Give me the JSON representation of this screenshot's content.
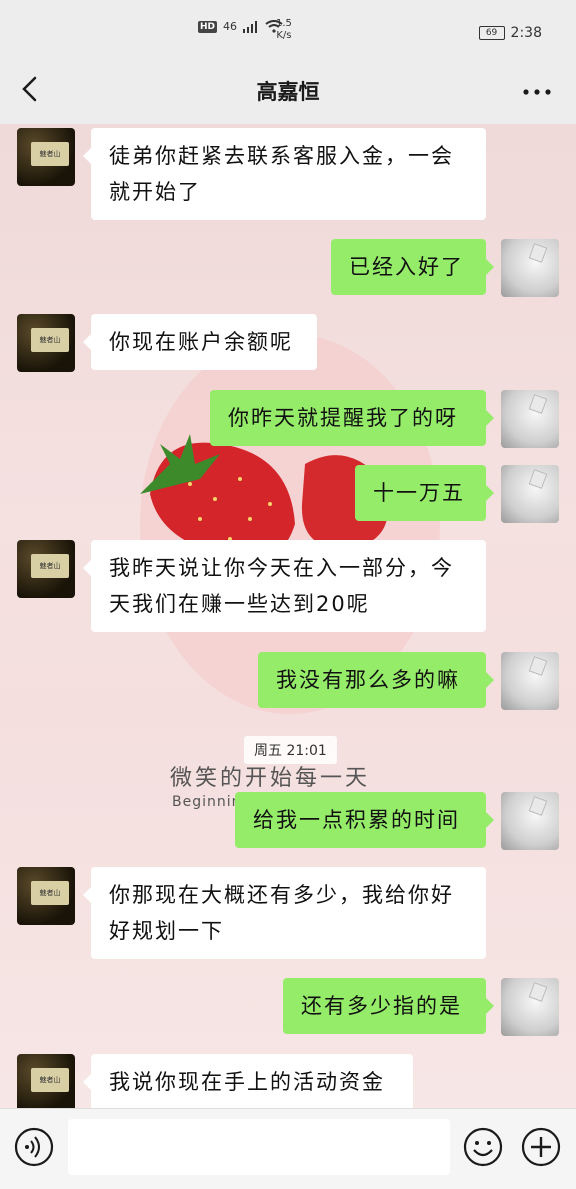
{
  "status": {
    "network": "46",
    "hd": "HD",
    "speed_value": "1.5",
    "speed_unit": "K/s",
    "battery": "69",
    "time": "2:38"
  },
  "header": {
    "title": "高嘉恒"
  },
  "messages": [
    {
      "side": "in",
      "text_lines": [
        "徒弟你赶紧去联系客服入金，一会",
        "就开始了"
      ]
    },
    {
      "side": "out",
      "text_lines": [
        "已经入好了"
      ]
    },
    {
      "side": "in",
      "text_lines": [
        "你现在账户余额呢"
      ]
    },
    {
      "side": "out",
      "text_lines": [
        "你昨天就提醒我了的呀"
      ]
    },
    {
      "side": "out",
      "text_lines": [
        "十一万五"
      ]
    },
    {
      "side": "in",
      "text_lines": [
        "我昨天说让你今天在入一部分，今",
        "天我们在赚一些达到20呢"
      ]
    },
    {
      "side": "out",
      "text_lines": [
        "我没有那么多的嘛"
      ]
    },
    {
      "side": "out",
      "text_lines": [
        "给我一点积累的时间"
      ]
    },
    {
      "side": "in",
      "text_lines": [
        "你那现在大概还有多少，我给你好",
        "好规划一下"
      ]
    },
    {
      "side": "out",
      "text_lines": [
        "还有多少指的是"
      ]
    },
    {
      "side": "in",
      "text_lines": [
        "我说你现在手上的活动资金"
      ]
    }
  ],
  "timestamp": "周五 21:01",
  "background": {
    "slogan": "微笑的开始每一天",
    "slogan_en": "Beginnin"
  },
  "avatar_left_text": "魅者山",
  "colors": {
    "out_bubble": "#95ec69",
    "in_bubble": "#ffffff",
    "bar": "#ededed"
  },
  "icons": {
    "back": "chevron-left-icon",
    "more": "more-dots-icon",
    "voice": "voice-icon",
    "emoji": "emoji-icon",
    "plus": "plus-icon"
  }
}
